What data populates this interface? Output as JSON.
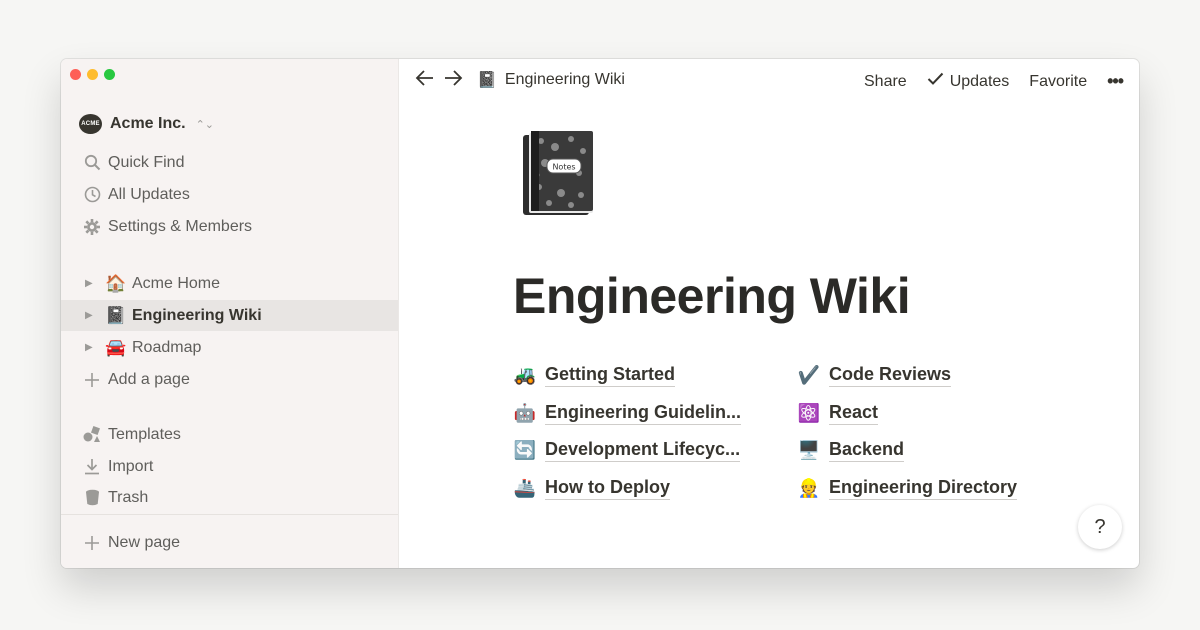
{
  "workspace": {
    "logo_text": "ACME",
    "name": "Acme Inc."
  },
  "sidebar": {
    "tools": [
      {
        "label": "Quick Find",
        "icon": "search-icon"
      },
      {
        "label": "All Updates",
        "icon": "clock-icon"
      },
      {
        "label": "Settings & Members",
        "icon": "gear-icon"
      }
    ],
    "pages": [
      {
        "label": "Acme Home",
        "emoji": "🏠"
      },
      {
        "label": "Engineering Wiki",
        "emoji": "📓",
        "active": true
      },
      {
        "label": "Roadmap",
        "emoji": "🚘"
      }
    ],
    "add_page": "Add a page",
    "bottom": [
      {
        "label": "Templates",
        "icon": "templates-icon"
      },
      {
        "label": "Import",
        "icon": "download-icon"
      },
      {
        "label": "Trash",
        "icon": "trash-icon"
      }
    ],
    "new_page": "New page"
  },
  "topbar": {
    "breadcrumb_emoji": "📓",
    "breadcrumb": "Engineering Wiki",
    "share": "Share",
    "updates": "Updates",
    "favorite": "Favorite",
    "more": "•••"
  },
  "page": {
    "icon_label": "Notes",
    "title": "Engineering Wiki",
    "links_left": [
      {
        "emoji": "🚜",
        "text": "Getting Started"
      },
      {
        "emoji": "🤖",
        "text": "Engineering Guidelin..."
      },
      {
        "emoji": "🔄",
        "text": "Development Lifecyc..."
      },
      {
        "emoji": "🚢",
        "text": "How to Deploy"
      }
    ],
    "links_right": [
      {
        "emoji": "✔️",
        "text": "Code Reviews"
      },
      {
        "emoji": "⚛️",
        "text": "React"
      },
      {
        "emoji": "🖥️",
        "text": "Backend"
      },
      {
        "emoji": "👷",
        "text": "Engineering Directory"
      }
    ]
  },
  "help": "?",
  "colors": {
    "sidebar_bg": "#f7f3f2",
    "active_row": "#e8e5e3",
    "text": "#37352f"
  }
}
